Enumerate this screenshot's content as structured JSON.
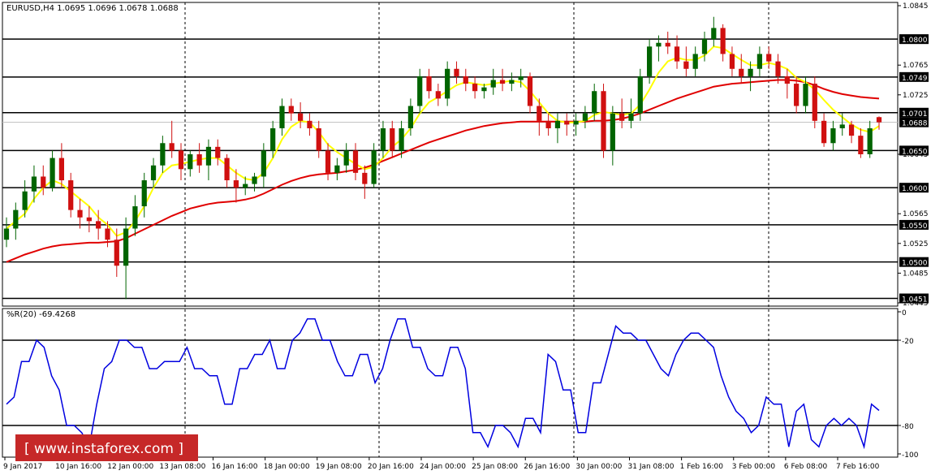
{
  "chart_data": [
    {
      "type": "candlestick",
      "title": "EURUSD,H4  1.0695 1.0696 1.0678 1.0688",
      "ylim": [
        1.0445,
        1.0845
      ],
      "price_ticks": [
        "1.0845",
        "1.0765",
        "1.0725",
        "1.0645",
        "1.0565",
        "1.0525",
        "1.0485",
        "1.0445"
      ],
      "levels": [
        {
          "value": 1.08,
          "label": "1.0800"
        },
        {
          "value": 1.0749,
          "label": "1.0749"
        },
        {
          "value": 1.0701,
          "label": "1.0701"
        },
        {
          "value": 1.065,
          "label": "1.0650"
        },
        {
          "value": 1.06,
          "label": "1.0600"
        },
        {
          "value": 1.055,
          "label": "1.0550"
        },
        {
          "value": 1.05,
          "label": "1.0500"
        },
        {
          "value": 1.0451,
          "label": "1.0451"
        }
      ],
      "current": {
        "value": 1.0688,
        "label": "1.0688"
      },
      "candles": [
        [
          1.053,
          1.056,
          1.052,
          1.0545
        ],
        [
          1.0545,
          1.058,
          1.053,
          1.057
        ],
        [
          1.057,
          1.061,
          1.056,
          1.0595
        ],
        [
          1.0595,
          1.063,
          1.058,
          1.0615
        ],
        [
          1.0615,
          1.063,
          1.059,
          1.06
        ],
        [
          1.06,
          1.065,
          1.0595,
          1.064
        ],
        [
          1.064,
          1.066,
          1.06,
          1.061
        ],
        [
          1.061,
          1.062,
          1.056,
          1.057
        ],
        [
          1.057,
          1.0585,
          1.0545,
          1.056
        ],
        [
          1.056,
          1.0575,
          1.054,
          1.0555
        ],
        [
          1.0555,
          1.057,
          1.053,
          1.0545
        ],
        [
          1.0545,
          1.0555,
          1.052,
          1.053
        ],
        [
          1.053,
          1.0545,
          1.048,
          1.0495
        ],
        [
          1.0495,
          1.056,
          1.045,
          1.0545
        ],
        [
          1.0545,
          1.059,
          1.0535,
          1.0575
        ],
        [
          1.0575,
          1.062,
          1.056,
          1.061
        ],
        [
          1.061,
          1.064,
          1.06,
          1.063
        ],
        [
          1.063,
          1.067,
          1.062,
          1.066
        ],
        [
          1.066,
          1.069,
          1.064,
          1.065
        ],
        [
          1.065,
          1.066,
          1.061,
          1.0625
        ],
        [
          1.0625,
          1.065,
          1.0615,
          1.0645
        ],
        [
          1.0645,
          1.066,
          1.062,
          1.063
        ],
        [
          1.063,
          1.0665,
          1.061,
          1.0655
        ],
        [
          1.0655,
          1.0665,
          1.063,
          1.064
        ],
        [
          1.064,
          1.0645,
          1.06,
          1.061
        ],
        [
          1.061,
          1.0625,
          1.058,
          1.06
        ],
        [
          1.06,
          1.0615,
          1.059,
          1.0605
        ],
        [
          1.0605,
          1.062,
          1.0595,
          1.0615
        ],
        [
          1.0615,
          1.066,
          1.06,
          1.065
        ],
        [
          1.065,
          1.069,
          1.064,
          1.068
        ],
        [
          1.068,
          1.072,
          1.067,
          1.071
        ],
        [
          1.071,
          1.072,
          1.069,
          1.07
        ],
        [
          1.07,
          1.0715,
          1.068,
          1.069
        ],
        [
          1.069,
          1.07,
          1.067,
          1.068
        ],
        [
          1.068,
          1.069,
          1.064,
          1.065
        ],
        [
          1.065,
          1.066,
          1.061,
          1.062
        ],
        [
          1.062,
          1.064,
          1.061,
          1.063
        ],
        [
          1.063,
          1.066,
          1.062,
          1.065
        ],
        [
          1.065,
          1.066,
          1.061,
          1.062
        ],
        [
          1.062,
          1.063,
          1.0585,
          1.0605
        ],
        [
          1.0605,
          1.066,
          1.06,
          1.065
        ],
        [
          1.065,
          1.069,
          1.064,
          1.068
        ],
        [
          1.068,
          1.069,
          1.064,
          1.065
        ],
        [
          1.065,
          1.069,
          1.064,
          1.068
        ],
        [
          1.068,
          1.072,
          1.067,
          1.071
        ],
        [
          1.071,
          1.076,
          1.07,
          1.075
        ],
        [
          1.075,
          1.076,
          1.072,
          1.073
        ],
        [
          1.073,
          1.074,
          1.071,
          1.072
        ],
        [
          1.072,
          1.077,
          1.071,
          1.076
        ],
        [
          1.076,
          1.077,
          1.074,
          1.075
        ],
        [
          1.075,
          1.076,
          1.073,
          1.074
        ],
        [
          1.074,
          1.075,
          1.072,
          1.073
        ],
        [
          1.073,
          1.074,
          1.072,
          1.0735
        ],
        [
          1.0735,
          1.076,
          1.0725,
          1.0745
        ],
        [
          1.0745,
          1.076,
          1.073,
          1.074
        ],
        [
          1.074,
          1.0755,
          1.073,
          1.0745
        ],
        [
          1.0745,
          1.076,
          1.0735,
          1.075
        ],
        [
          1.075,
          1.0755,
          1.07,
          1.071
        ],
        [
          1.071,
          1.072,
          1.067,
          1.069
        ],
        [
          1.069,
          1.07,
          1.067,
          1.068
        ],
        [
          1.068,
          1.07,
          1.066,
          1.069
        ],
        [
          1.069,
          1.07,
          1.067,
          1.0685
        ],
        [
          1.0685,
          1.07,
          1.067,
          1.069
        ],
        [
          1.069,
          1.071,
          1.068,
          1.07
        ],
        [
          1.07,
          1.074,
          1.069,
          1.073
        ],
        [
          1.073,
          1.074,
          1.064,
          1.065
        ],
        [
          1.065,
          1.071,
          1.063,
          1.07
        ],
        [
          1.07,
          1.072,
          1.068,
          1.069
        ],
        [
          1.069,
          1.072,
          1.068,
          1.07
        ],
        [
          1.07,
          1.076,
          1.069,
          1.075
        ],
        [
          1.075,
          1.08,
          1.074,
          1.079
        ],
        [
          1.079,
          1.0805,
          1.077,
          1.0795
        ],
        [
          1.0795,
          1.081,
          1.078,
          1.079
        ],
        [
          1.079,
          1.0805,
          1.076,
          1.077
        ],
        [
          1.077,
          1.079,
          1.075,
          1.076
        ],
        [
          1.076,
          1.079,
          1.075,
          1.078
        ],
        [
          1.078,
          1.081,
          1.077,
          1.08
        ],
        [
          1.08,
          1.083,
          1.079,
          1.0815
        ],
        [
          1.0815,
          1.082,
          1.077,
          1.078
        ],
        [
          1.078,
          1.079,
          1.075,
          1.076
        ],
        [
          1.076,
          1.078,
          1.074,
          1.075
        ],
        [
          1.075,
          1.077,
          1.073,
          1.076
        ],
        [
          1.076,
          1.079,
          1.075,
          1.078
        ],
        [
          1.078,
          1.079,
          1.076,
          1.077
        ],
        [
          1.077,
          1.078,
          1.074,
          1.075
        ],
        [
          1.075,
          1.076,
          1.072,
          1.074
        ],
        [
          1.074,
          1.075,
          1.07,
          1.071
        ],
        [
          1.071,
          1.075,
          1.07,
          1.074
        ],
        [
          1.074,
          1.075,
          1.068,
          1.069
        ],
        [
          1.069,
          1.07,
          1.0655,
          1.066
        ],
        [
          1.066,
          1.069,
          1.065,
          1.068
        ],
        [
          1.068,
          1.07,
          1.067,
          1.0685
        ],
        [
          1.0685,
          1.069,
          1.066,
          1.067
        ],
        [
          1.067,
          1.068,
          1.064,
          1.0645
        ],
        [
          1.0645,
          1.069,
          1.064,
          1.068
        ],
        [
          1.0695,
          1.0696,
          1.0678,
          1.0688
        ]
      ],
      "ma_fast": [
        1.0545,
        1.0555,
        1.0565,
        1.0585,
        1.06,
        1.061,
        1.0605,
        1.0595,
        1.0585,
        1.0575,
        1.056,
        1.055,
        1.0535,
        1.054,
        1.0555,
        1.0575,
        1.06,
        1.062,
        1.063,
        1.0632,
        1.0635,
        1.0638,
        1.064,
        1.064,
        1.063,
        1.062,
        1.0612,
        1.061,
        1.062,
        1.064,
        1.0665,
        1.0682,
        1.069,
        1.0688,
        1.0675,
        1.0658,
        1.0648,
        1.064,
        1.0632,
        1.0625,
        1.0628,
        1.064,
        1.0655,
        1.0665,
        1.068,
        1.07,
        1.0715,
        1.0722,
        1.073,
        1.0738,
        1.0742,
        1.074,
        1.0738,
        1.074,
        1.0742,
        1.0744,
        1.0742,
        1.073,
        1.0715,
        1.07,
        1.069,
        1.0688,
        1.0688,
        1.069,
        1.0698,
        1.0702,
        1.07,
        1.0698,
        1.07,
        1.0712,
        1.0732,
        1.0755,
        1.077,
        1.0775,
        1.0772,
        1.0772,
        1.0778,
        1.079,
        1.0788,
        1.078,
        1.0772,
        1.0765,
        1.0765,
        1.0768,
        1.0765,
        1.076,
        1.0748,
        1.0742,
        1.0732,
        1.0718,
        1.0705,
        1.0695,
        1.0685,
        1.0678,
        1.0675,
        1.0683
      ],
      "ma_slow": [
        1.05,
        1.0505,
        1.051,
        1.0514,
        1.0518,
        1.0521,
        1.0523,
        1.0524,
        1.0525,
        1.0526,
        1.0526,
        1.0527,
        1.0528,
        1.0532,
        1.0538,
        1.0544,
        1.055,
        1.0556,
        1.0562,
        1.0567,
        1.0572,
        1.0575,
        1.0578,
        1.058,
        1.0581,
        1.0582,
        1.0584,
        1.0587,
        1.0592,
        1.0598,
        1.0604,
        1.0609,
        1.0613,
        1.0616,
        1.0618,
        1.0619,
        1.062,
        1.0622,
        1.0624,
        1.0627,
        1.0631,
        1.0636,
        1.0641,
        1.0646,
        1.0651,
        1.0656,
        1.0661,
        1.0665,
        1.0669,
        1.0673,
        1.0677,
        1.068,
        1.0683,
        1.0685,
        1.0687,
        1.0688,
        1.0689,
        1.0689,
        1.0689,
        1.0689,
        1.0689,
        1.0689,
        1.0689,
        1.0689,
        1.069,
        1.069,
        1.0691,
        1.0693,
        1.0696,
        1.07,
        1.0705,
        1.071,
        1.0715,
        1.072,
        1.0724,
        1.0728,
        1.0732,
        1.0736,
        1.0738,
        1.074,
        1.0741,
        1.0742,
        1.0743,
        1.0744,
        1.0745,
        1.0745,
        1.0744,
        1.0742,
        1.0738,
        1.0733,
        1.0729,
        1.0726,
        1.0724,
        1.0722,
        1.0721,
        1.072
      ]
    },
    {
      "type": "line",
      "title": "%R(20) -69.4268",
      "ylim": [
        -100,
        0
      ],
      "ticks": [
        "0",
        "-100"
      ],
      "levels": [
        {
          "value": -20,
          "label": "-20"
        },
        {
          "value": -80,
          "label": "-80"
        }
      ],
      "values": [
        -65,
        -60,
        -35,
        -35,
        -20,
        -25,
        -45,
        -55,
        -80,
        -80,
        -85,
        -95,
        -65,
        -40,
        -35,
        -20,
        -20,
        -25,
        -25,
        -40,
        -40,
        -35,
        -35,
        -35,
        -25,
        -40,
        -40,
        -45,
        -45,
        -65,
        -65,
        -40,
        -40,
        -30,
        -30,
        -20,
        -40,
        -40,
        -20,
        -15,
        -5,
        -5,
        -20,
        -20,
        -35,
        -45,
        -45,
        -30,
        -30,
        -50,
        -40,
        -20,
        -5,
        -5,
        -25,
        -25,
        -40,
        -45,
        -45,
        -25,
        -25,
        -40,
        -85,
        -85,
        -95,
        -80,
        -80,
        -85,
        -95,
        -75,
        -75,
        -85,
        -30,
        -35,
        -55,
        -55,
        -85,
        -85,
        -50,
        -50,
        -30,
        -10,
        -15,
        -15,
        -20,
        -20,
        -30,
        -40,
        -45,
        -30,
        -20,
        -15,
        -15,
        -20,
        -25,
        -45,
        -60,
        -70,
        -75,
        -85,
        -80,
        -60,
        -65,
        -65,
        -95,
        -70,
        -65,
        -90,
        -95,
        -80,
        -75,
        -80,
        -75,
        -80,
        -95,
        -65,
        -69.4268
      ]
    }
  ],
  "time_labels": [
    "9 Jan 2017",
    "10 Jan 16:00",
    "12 Jan 00:00",
    "13 Jan 08:00",
    "16 Jan 16:00",
    "18 Jan 00:00",
    "19 Jan 08:00",
    "20 Jan 16:00",
    "24 Jan 00:00",
    "25 Jan 08:00",
    "26 Jan 16:00",
    "30 Jan 00:00",
    "31 Jan 08:00",
    "1 Feb 16:00",
    "3 Feb 00:00",
    "6 Feb 08:00",
    "7 Feb 16:00"
  ],
  "colors": {
    "bull": "#006400",
    "bear": "#d01010",
    "ma_fast": "#ffff00",
    "ma_slow": "#e00000",
    "wpr": "#0000e0",
    "watermark_bg": "#c62828"
  },
  "watermark": "[  www.instaforex.com  ]"
}
